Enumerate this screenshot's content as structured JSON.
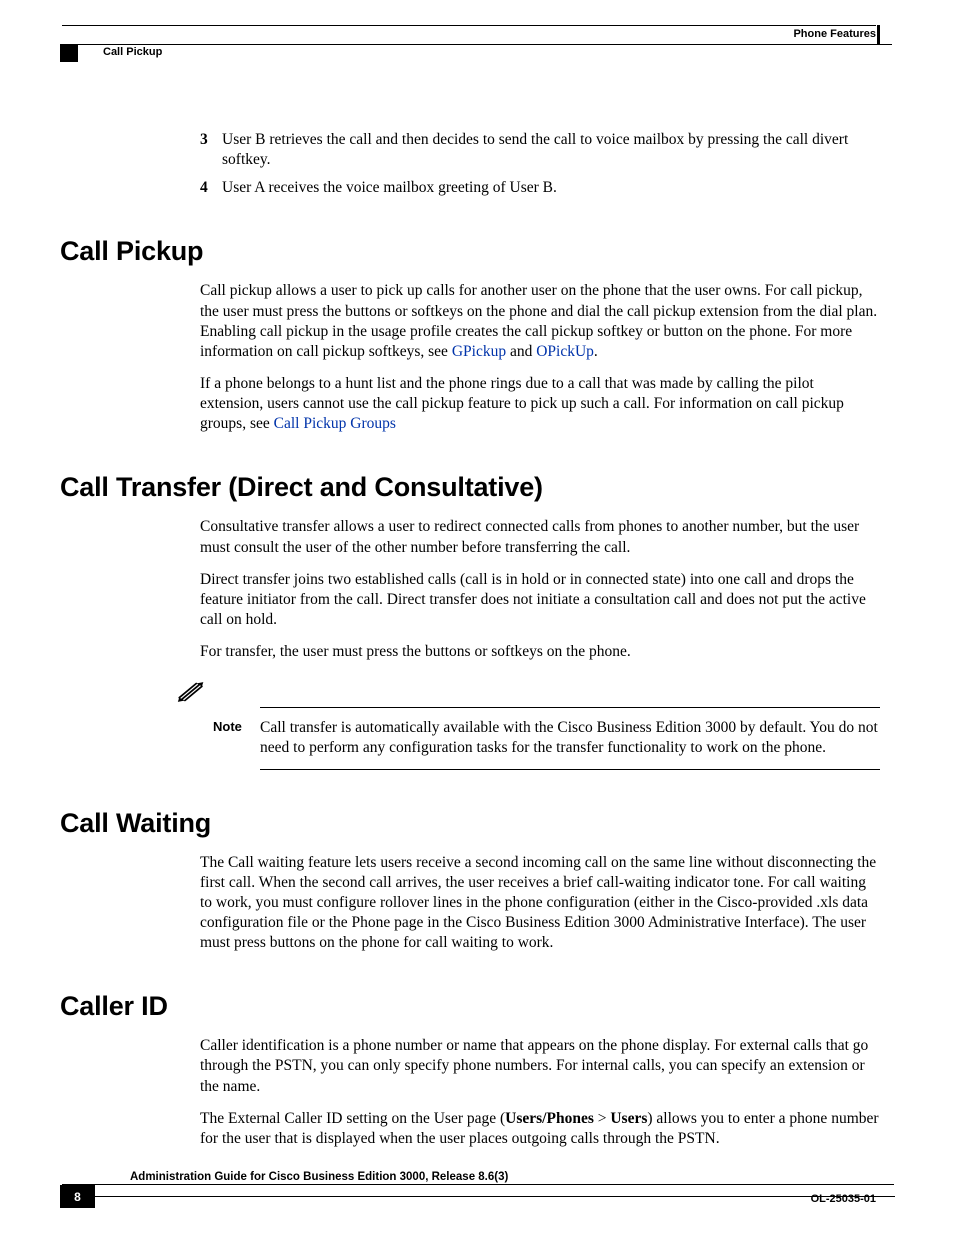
{
  "header": {
    "right": "Phone Features",
    "left": "Call Pickup"
  },
  "list": {
    "item3_num": "3",
    "item3_txt": "User B retrieves the call and then decides to send the call to voice mailbox by pressing the call divert softkey.",
    "item4_num": "4",
    "item4_txt": "User A receives the voice mailbox greeting of User B."
  },
  "sec1": {
    "heading": "Call Pickup",
    "p1a": "Call pickup allows a user to pick up calls for another user on the phone that the user owns. For call pickup, the user must press the buttons or softkeys on the phone and dial the call pickup extension from the dial plan. Enabling call pickup in the usage profile creates the call pickup softkey or button on the phone. For more information on call pickup softkeys, see ",
    "link1": "GPickup",
    "p1b": " and ",
    "link2": "OPickUp",
    "p1c": ".",
    "p2a": "If a phone belongs to a hunt list and the phone rings due to a call that was made by calling the pilot extension, users cannot use the call pickup feature to pick up such a call. For information on call pickup groups, see ",
    "link3": "Call Pickup Groups"
  },
  "sec2": {
    "heading": "Call Transfer (Direct and Consultative)",
    "p1": "Consultative transfer allows a user to redirect connected calls from phones to another number, but the user must consult the user of the other number before transferring the call.",
    "p2": "Direct transfer joins two established calls (call is in hold or in connected state) into one call and drops the feature initiator from the call. Direct transfer does not initiate a consultation call and does not put the active call on hold.",
    "p3": "For transfer, the user must press the buttons or softkeys on the phone.",
    "note_label": "Note",
    "note_body": "Call transfer is automatically available with the Cisco Business Edition 3000 by default. You do not need to perform any configuration tasks for the transfer functionality to work on the phone."
  },
  "sec3": {
    "heading": "Call Waiting",
    "p1": "The Call waiting feature lets users receive a second incoming call on the same line without disconnecting the first call. When the second call arrives, the user receives a brief call-waiting indicator tone. For call waiting to work, you must configure rollover lines in the phone configuration (either in the Cisco-provided .xls data configuration file or the Phone page in the Cisco Business Edition 3000 Administrative Interface). The user must press buttons on the phone for call waiting to work."
  },
  "sec4": {
    "heading": "Caller ID",
    "p1": "Caller identification is a phone number or name that appears on the phone display. For external calls that go through the PSTN, you can only specify phone numbers. For internal calls, you can specify an extension or the name.",
    "p2a": "The External Caller ID setting on the User page (",
    "p2_bold1": "Users/Phones",
    "p2b": " > ",
    "p2_bold2": "Users",
    "p2c": ") allows you to enter a phone number for the user that is displayed when the user places outgoing calls through the PSTN."
  },
  "footer": {
    "title": "Administration Guide for Cisco Business Edition 3000, Release 8.6(3)",
    "page": "8",
    "docid": "OL-25035-01"
  }
}
